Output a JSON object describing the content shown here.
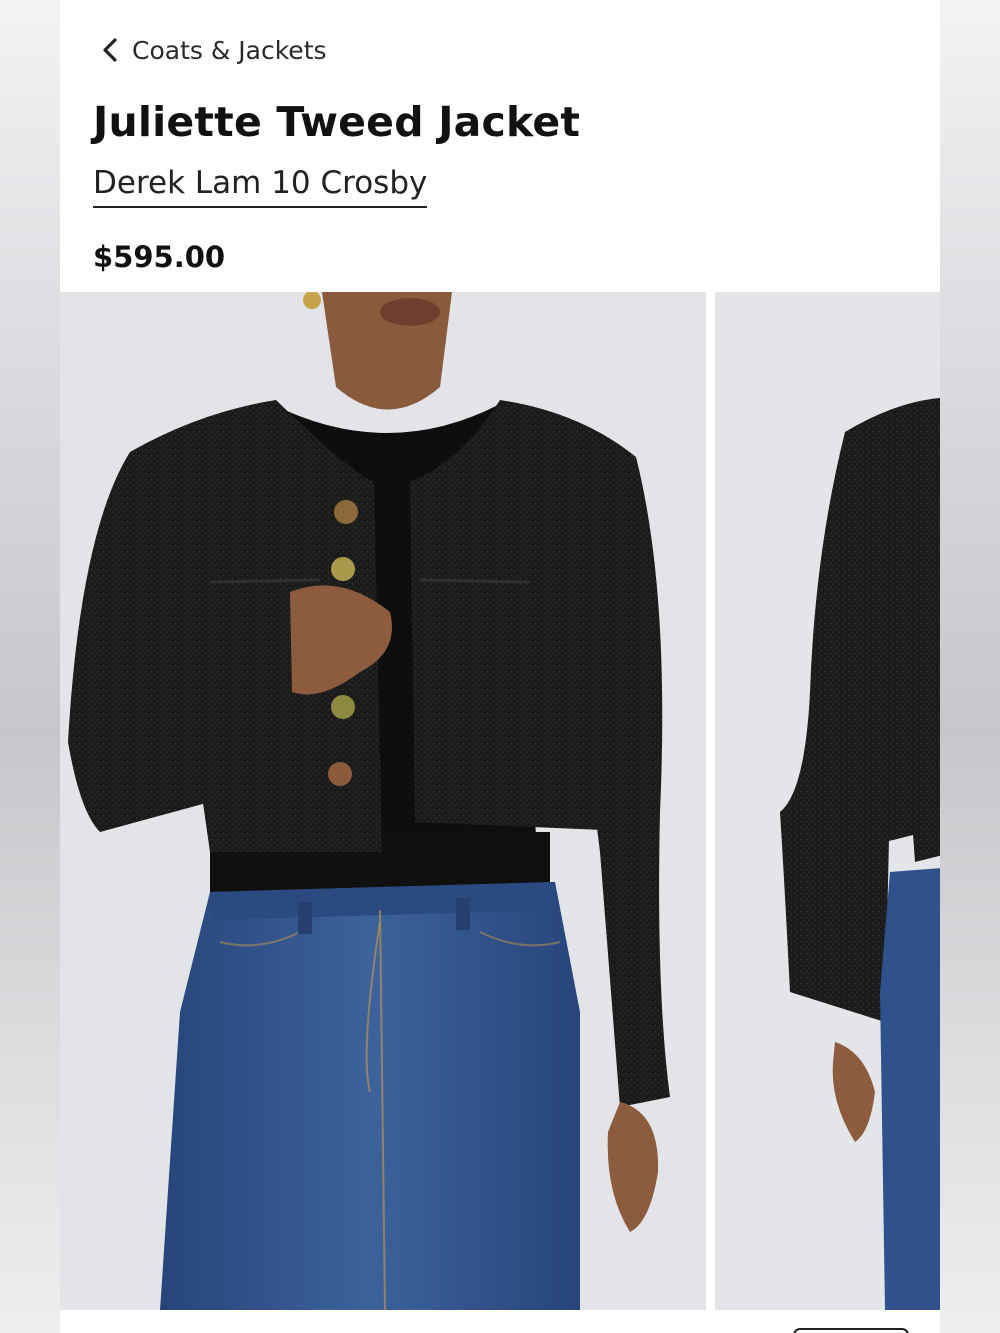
{
  "nav": {
    "back_icon": "chevron-left-icon",
    "breadcrumb_label": "Coats & Jackets"
  },
  "product": {
    "title": "Juliette Tweed Jacket",
    "brand": "Derek Lam 10 Crosby",
    "price": "$595.00"
  },
  "gallery": {
    "images": [
      {
        "name": "product-image-front"
      },
      {
        "name": "product-image-side"
      }
    ]
  },
  "colors": {
    "background": "#ffffff",
    "text": "#111111",
    "jacket": "#1a1a1b",
    "denim": "#2f4f86",
    "image_backdrop": "#e3e4e8"
  }
}
